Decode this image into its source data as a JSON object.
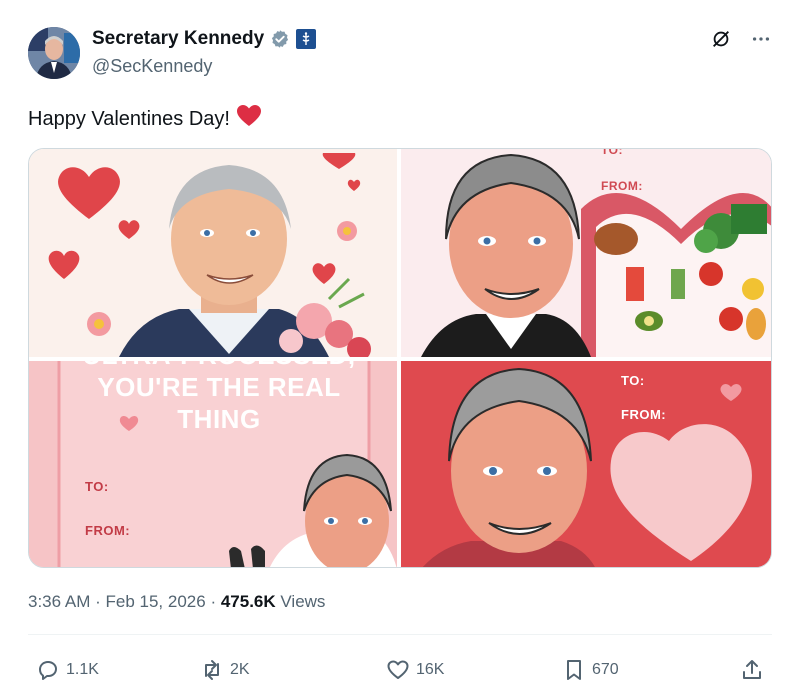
{
  "author": {
    "name": "Secretary Kennedy",
    "handle": "@SecKennedy"
  },
  "post": {
    "text": "Happy Valentines Day!",
    "emoji": "❤"
  },
  "cards": {
    "card2": {
      "to": "TO:",
      "from": "FROM:"
    },
    "card3": {
      "headline_line1": "ULTRA-PROCESSED,",
      "headline_line2": "YOU'RE THE REAL",
      "headline_line3": "THING",
      "to": "TO:",
      "from": "FROM:"
    },
    "card4": {
      "to": "TO:",
      "from": "FROM:"
    }
  },
  "meta": {
    "time": "3:36 AM",
    "date": "Feb 15, 2026",
    "views_count": "475.6K",
    "views_label": "Views"
  },
  "actions": {
    "replies": "1.1K",
    "reposts": "2K",
    "likes": "16K",
    "bookmarks": "670"
  },
  "icons": {
    "verified": "verified-check-icon",
    "gov": "gov-affiliation-icon",
    "grok": "grok-icon",
    "more": "more-dots-icon",
    "reply": "reply-icon",
    "repost": "repost-icon",
    "like": "heart-icon",
    "bookmark": "bookmark-icon",
    "share": "share-icon"
  },
  "colors": {
    "accent": "#1d9bf0",
    "heart": "#e0245e",
    "muted": "#536471",
    "text": "#0f1419"
  }
}
